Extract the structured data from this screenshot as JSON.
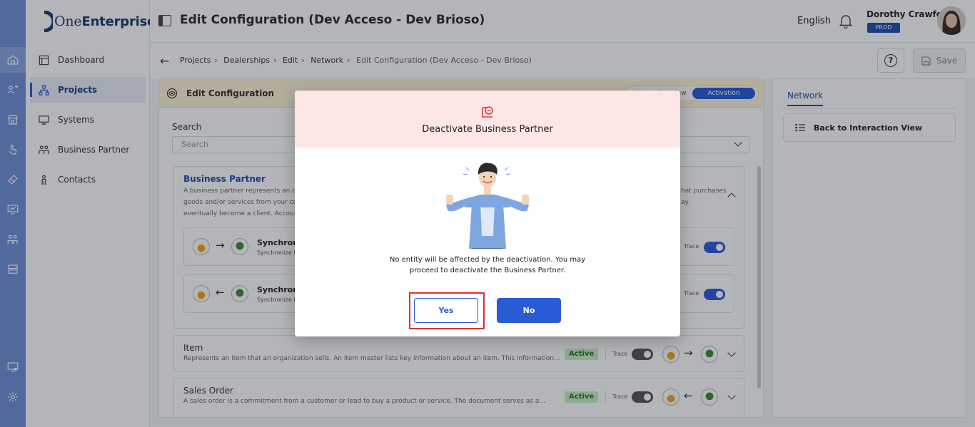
{
  "app": {
    "brand_prefix": "One",
    "brand_suffix": "Enterprise",
    "page_title": "Edit Configuration (Dev Acceso - Dev Brioso)"
  },
  "header": {
    "language": "English",
    "user_name": "Dorothy Crawford",
    "environment": "PROD"
  },
  "sidebar": {
    "items": [
      {
        "label": "Dashboard",
        "icon": "dashboard-icon",
        "active": false
      },
      {
        "label": "Projects",
        "icon": "projects-icon",
        "active": true
      },
      {
        "label": "Systems",
        "icon": "systems-icon",
        "active": false
      },
      {
        "label": "Business Partner",
        "icon": "business-partner-icon",
        "active": false
      },
      {
        "label": "Contacts",
        "icon": "contacts-icon",
        "active": false
      }
    ]
  },
  "breadcrumb": {
    "items": [
      "Projects",
      "Dealerships",
      "Edit",
      "Network"
    ],
    "current": "Edit Configuration (Dev Acceso - Dev Brioso)"
  },
  "toolbar": {
    "save_label": "Save"
  },
  "card": {
    "title": "Edit Configuration",
    "view_options": [
      "Interaction View",
      "Activation"
    ],
    "search_label": "Search",
    "search_placeholder": "Search"
  },
  "sections": {
    "business_partner": {
      "title": "Business Partner",
      "desc_line1": "A business partner represents an organiza",
      "desc_line1_right": "hat purchases",
      "desc_line2": "goods and/or services from your company",
      "desc_line2_right": "ay",
      "desc_line3": "eventually become a client. Account - An o",
      "flows": [
        {
          "name": "Synchroniz",
          "sub": "Synchronize E",
          "direction": "right",
          "trace": "Trace"
        },
        {
          "name": "Synchroniz",
          "sub": "Synchronize E",
          "direction": "left",
          "trace": "Trace"
        }
      ]
    },
    "item": {
      "title": "Item",
      "desc": "Represents an item that an organization sells. An item master lists key information about an item. This information...",
      "status": "Active",
      "trace": "Trace"
    },
    "sales_order": {
      "title": "Sales Order",
      "desc": "A sales order is a commitment from a customer or lead to buy a product or service. The document serves as a...",
      "status": "Active",
      "trace": "Trace"
    }
  },
  "right_panel": {
    "tab": "Network",
    "back_button": "Back to Interaction View"
  },
  "modal": {
    "title": "Deactivate Business Partner",
    "message_line1": "No entity will be affected by the deactivation. You may",
    "message_line2": "proceed to deactivate the Business Partner.",
    "yes_label": "Yes",
    "no_label": "No"
  },
  "colors": {
    "rail": "#6f8fd8",
    "primary": "#2a5bd7",
    "modal_header": "#fde6e6",
    "highlight": "#e03131",
    "active_badge": "#c9f0c5"
  }
}
